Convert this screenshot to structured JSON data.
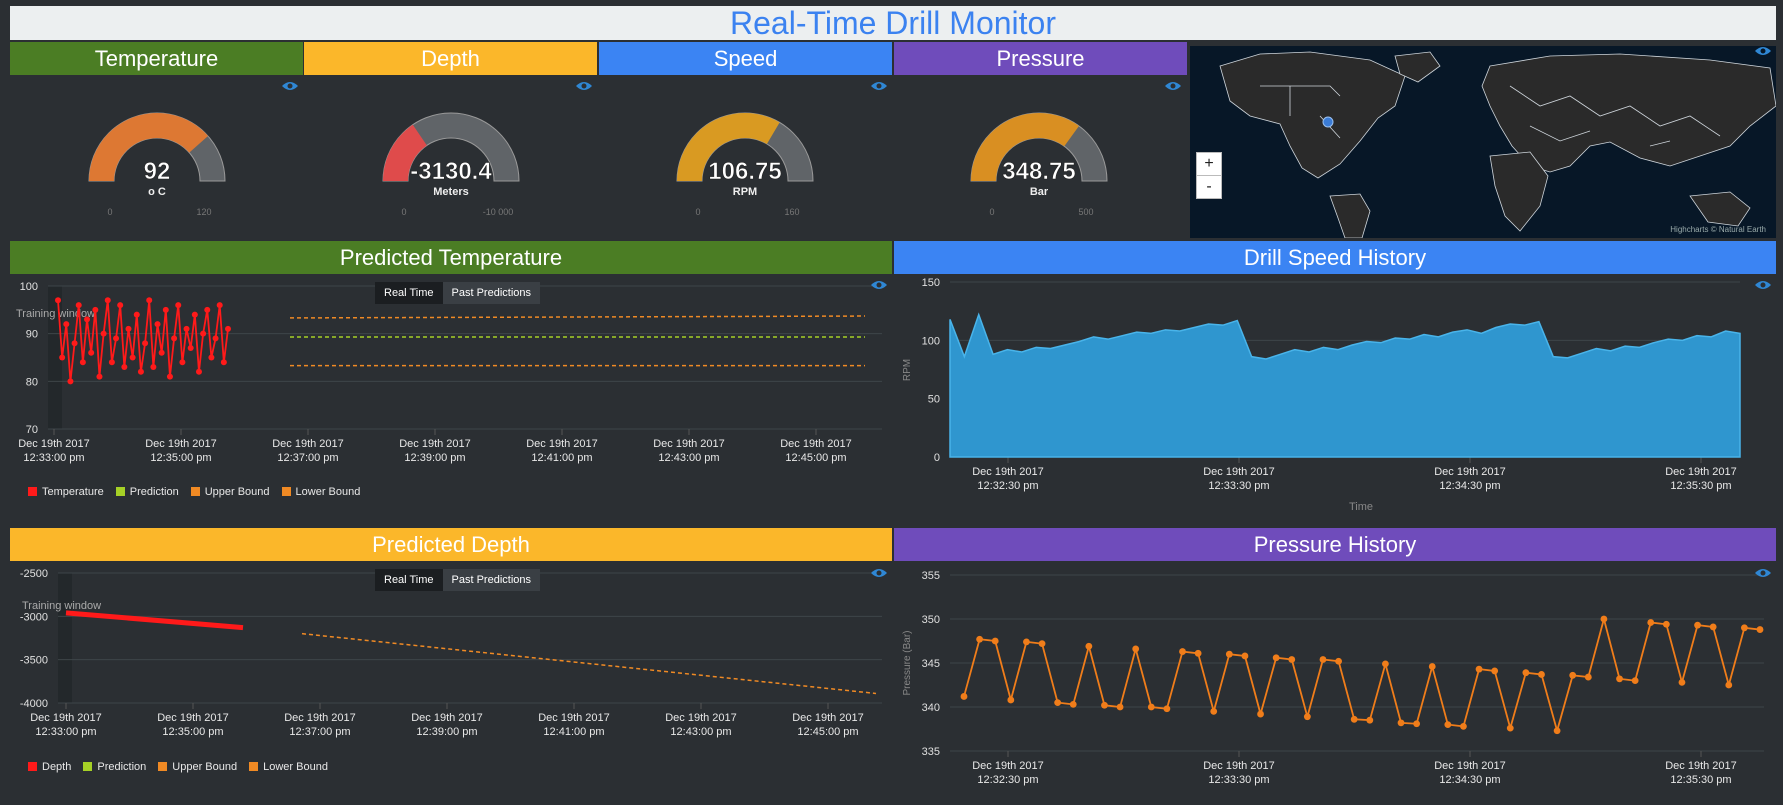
{
  "title": "Real-Time Drill Monitor",
  "colors": {
    "green": "#4b7d24",
    "yellow": "#fbb72a",
    "blue": "#3b84f3",
    "purple": "#6f4cbb"
  },
  "gauges": [
    {
      "header": "Temperature",
      "value": "92",
      "unit": "o C",
      "min": "0",
      "max": "120",
      "fraction": 0.77,
      "color": "#dd7833"
    },
    {
      "header": "Depth",
      "value": "-3130.4",
      "unit": "Meters",
      "min": "0",
      "max": "-10 000",
      "fraction": 0.31,
      "color": "#df4b4b"
    },
    {
      "header": "Speed",
      "value": "106.75",
      "unit": "RPM",
      "min": "0",
      "max": "160",
      "fraction": 0.67,
      "color": "#d99a22"
    },
    {
      "header": "Pressure",
      "value": "348.75",
      "unit": "Bar",
      "min": "0",
      "max": "500",
      "fraction": 0.7,
      "color": "#d98f22"
    }
  ],
  "map": {
    "zoom_in": "+",
    "zoom_out": "-",
    "credit": "Highcharts © Natural Earth"
  },
  "predicted_temperature": {
    "header": "Predicted Temperature",
    "tabs": [
      "Real Time",
      "Past Predictions"
    ],
    "annotation": "Training window",
    "chart_data": {
      "type": "line",
      "ylim": [
        70,
        100
      ],
      "yticks": [
        "100",
        "90",
        "80",
        "70"
      ],
      "xticks": [
        [
          "Dec 19th 2017",
          "12:33:00 pm"
        ],
        [
          "Dec 19th 2017",
          "12:35:00 pm"
        ],
        [
          "Dec 19th 2017",
          "12:37:00 pm"
        ],
        [
          "Dec 19th 2017",
          "12:39:00 pm"
        ],
        [
          "Dec 19th 2017",
          "12:41:00 pm"
        ],
        [
          "Dec 19th 2017",
          "12:43:00 pm"
        ],
        [
          "Dec 19th 2017",
          "12:45:00 pm"
        ]
      ],
      "series": [
        {
          "name": "Temperature",
          "color": "#ff1a1a",
          "values": [
            97,
            85,
            92,
            80,
            88,
            96,
            84,
            93,
            86,
            95,
            81,
            90,
            97,
            84,
            89,
            96,
            83,
            91,
            85,
            94,
            82,
            88,
            97,
            83,
            92,
            86,
            95,
            81,
            89,
            96,
            84,
            91,
            87,
            94,
            82,
            90,
            95,
            85,
            89,
            96,
            84,
            91
          ]
        },
        {
          "name": "Prediction",
          "color": "#a6d126",
          "values": [
            89.3,
            89.3
          ]
        },
        {
          "name": "Upper Bound",
          "color": "#f08a24",
          "values": [
            93.3,
            93.7
          ]
        },
        {
          "name": "Lower Bound",
          "color": "#f08a24",
          "values": [
            83.3,
            83.3
          ]
        }
      ]
    }
  },
  "drill_speed_history": {
    "header": "Drill Speed History",
    "chart_data": {
      "type": "area",
      "ylabel": "RPM",
      "xlabel": "Time",
      "ylim": [
        0,
        150
      ],
      "yticks": [
        "150",
        "100",
        "50",
        "0"
      ],
      "xticks": [
        [
          "Dec 19th 2017",
          "12:32:30 pm"
        ],
        [
          "Dec 19th 2017",
          "12:33:30 pm"
        ],
        [
          "Dec 19th 2017",
          "12:34:30 pm"
        ],
        [
          "Dec 19th 2017",
          "12:35:30 pm"
        ]
      ],
      "values": [
        118,
        86,
        122,
        88,
        92,
        90,
        94,
        93,
        96,
        99,
        103,
        101,
        104,
        107,
        106,
        109,
        108,
        111,
        114,
        113,
        117,
        86,
        84,
        88,
        92,
        90,
        94,
        92,
        96,
        99,
        98,
        102,
        101,
        105,
        103,
        107,
        109,
        106,
        111,
        114,
        113,
        116,
        86,
        85,
        89,
        93,
        91,
        95,
        94,
        98,
        101,
        100,
        104,
        103,
        108,
        106
      ]
    }
  },
  "predicted_depth": {
    "header": "Predicted Depth",
    "tabs": [
      "Real Time",
      "Past Predictions"
    ],
    "annotation": "Training window",
    "chart_data": {
      "type": "line",
      "ylim": [
        -4000,
        -2500
      ],
      "yticks": [
        "-2500",
        "-3000",
        "-3500",
        "-4000"
      ],
      "xticks": [
        [
          "Dec 19th 2017",
          "12:33:00 pm"
        ],
        [
          "Dec 19th 2017",
          "12:35:00 pm"
        ],
        [
          "Dec 19th 2017",
          "12:37:00 pm"
        ],
        [
          "Dec 19th 2017",
          "12:39:00 pm"
        ],
        [
          "Dec 19th 2017",
          "12:41:00 pm"
        ],
        [
          "Dec 19th 2017",
          "12:43:00 pm"
        ],
        [
          "Dec 19th 2017",
          "12:45:00 pm"
        ]
      ],
      "series": [
        {
          "name": "Depth",
          "color": "#ff1a1a",
          "values": [
            -2960,
            -3130
          ]
        },
        {
          "name": "Prediction",
          "color": "#a6d126",
          "values": [
            -3200,
            -3890
          ]
        },
        {
          "name": "Upper Bound",
          "color": "#f08a24",
          "values": [
            -3200,
            -3890
          ]
        },
        {
          "name": "Lower Bound",
          "color": "#f08a24",
          "values": [
            -3200,
            -3890
          ]
        }
      ]
    }
  },
  "pressure_history": {
    "header": "Pressure History",
    "chart_data": {
      "type": "line",
      "ylabel": "Pressure (Bar)",
      "ylim": [
        335,
        355
      ],
      "yticks": [
        "355",
        "350",
        "345",
        "340",
        "335"
      ],
      "xticks": [
        [
          "Dec 19th 2017",
          "12:32:30 pm"
        ],
        [
          "Dec 19th 2017",
          "12:33:30 pm"
        ],
        [
          "Dec 19th 2017",
          "12:34:30 pm"
        ],
        [
          "Dec 19th 2017",
          "12:35:30 pm"
        ]
      ],
      "values": [
        341.2,
        347.7,
        347.5,
        340.8,
        347.4,
        347.2,
        340.5,
        340.3,
        346.9,
        340.2,
        340,
        346.6,
        340,
        339.8,
        346.3,
        346.1,
        339.5,
        346,
        345.8,
        339.2,
        345.6,
        345.4,
        338.9,
        345.4,
        345.2,
        338.6,
        338.5,
        344.9,
        338.2,
        338.1,
        344.6,
        338,
        337.8,
        344.3,
        344.1,
        337.6,
        343.9,
        343.7,
        337.3,
        343.6,
        343.4,
        350,
        343.2,
        343,
        349.6,
        349.4,
        342.8,
        349.3,
        349.1,
        342.5,
        349,
        348.8
      ]
    }
  }
}
